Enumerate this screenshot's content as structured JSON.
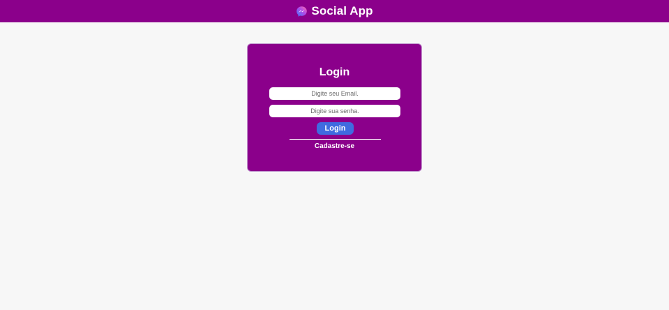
{
  "header": {
    "title": "Social App",
    "logo_icon": "messenger-icon",
    "background": "#8b008b"
  },
  "login_card": {
    "title": "Login",
    "email_placeholder": "Digite seu Email.",
    "password_placeholder": "Digite sua senha.",
    "login_button_label": "Login",
    "signup_link_label": "Cadastre-se",
    "background": "#8b008b",
    "button_color": "#3f6be0"
  }
}
